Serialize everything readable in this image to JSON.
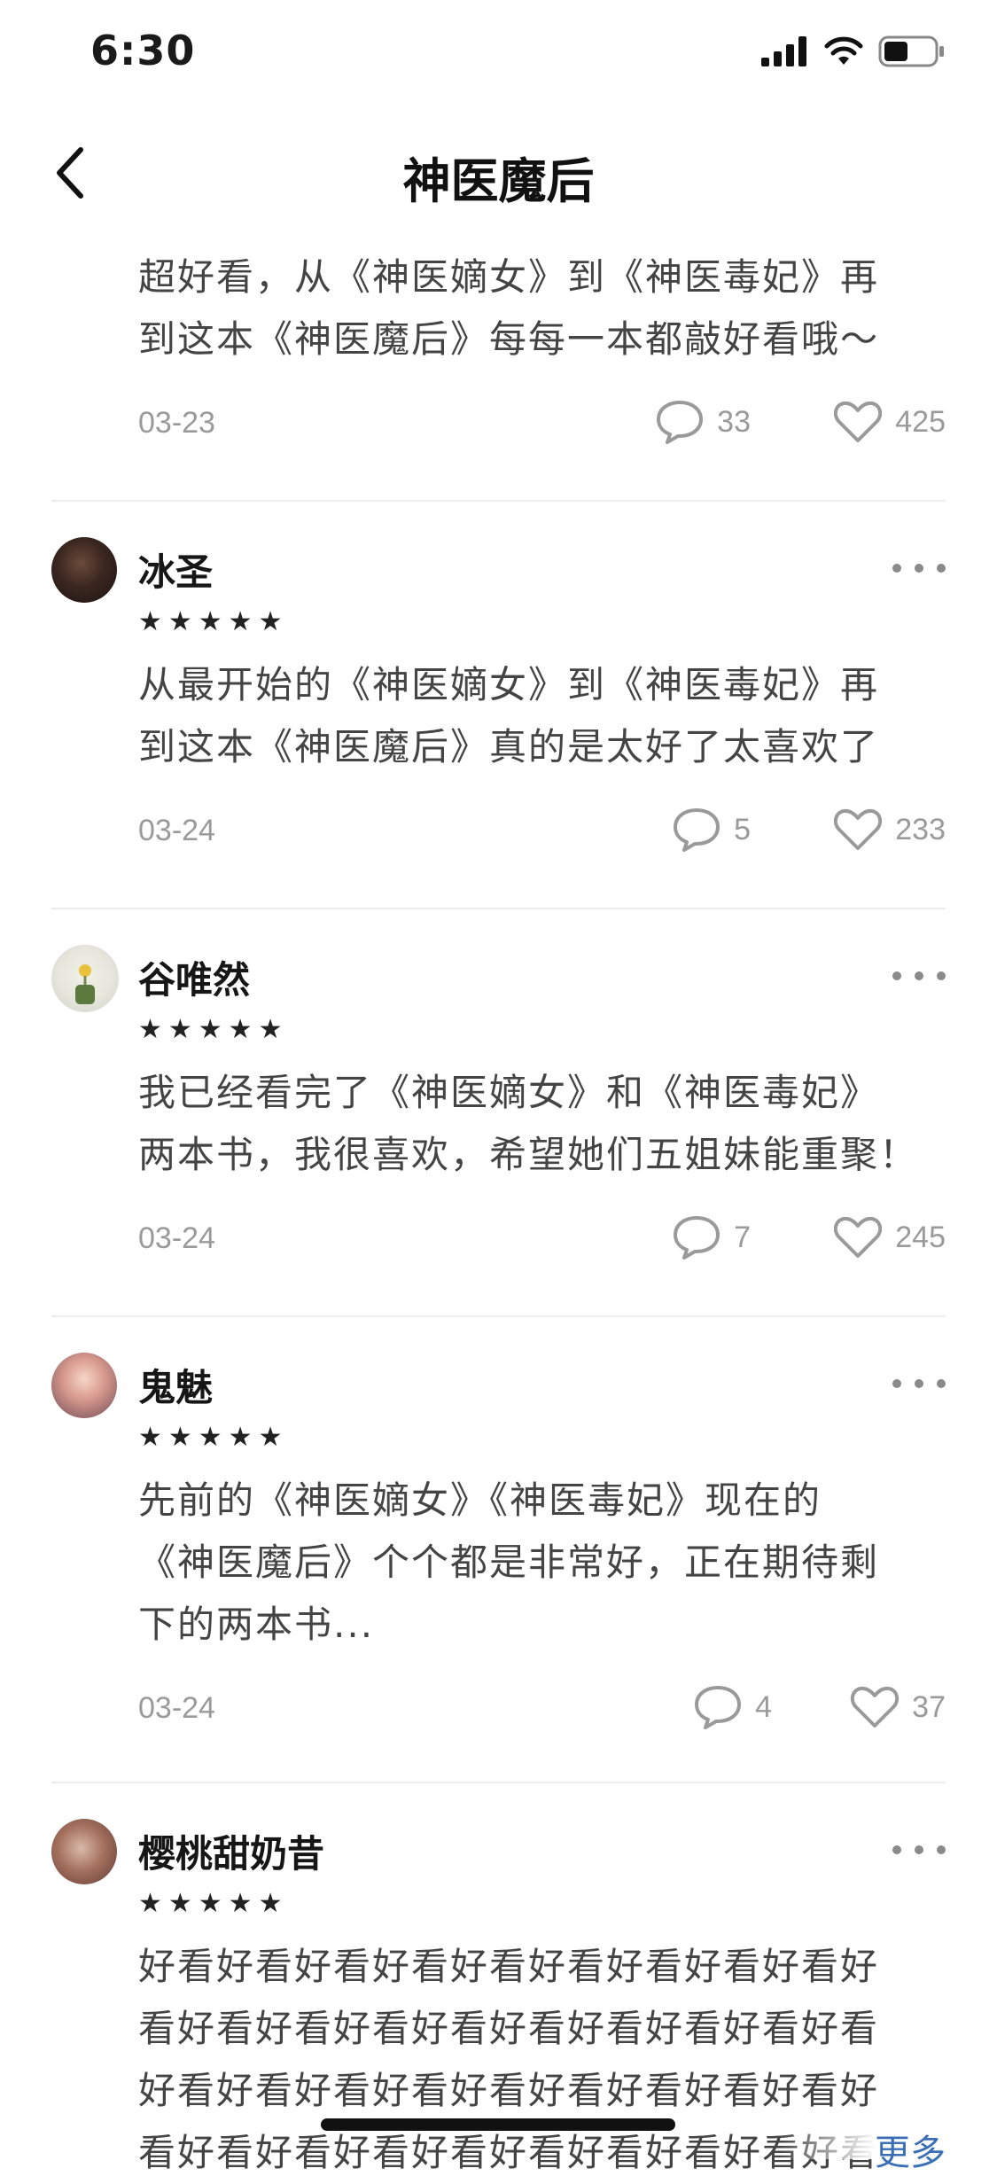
{
  "status_bar": {
    "time": "6:30"
  },
  "nav": {
    "title": "神医魔后"
  },
  "reviews": [
    {
      "content": "超好看，从《神医嫡女》到《神医毒妃》再\n到这本《神医魔后》每每一本都敲好看哦～",
      "date": "03-23",
      "comments": "33",
      "likes": "425"
    },
    {
      "username": "冰圣",
      "stars": "★★★★★",
      "content": "从最开始的《神医嫡女》到《神医毒妃》再\n到这本《神医魔后》真的是太好了太喜欢了",
      "date": "03-24",
      "comments": "5",
      "likes": "233"
    },
    {
      "username": "谷唯然",
      "stars": "★★★★★",
      "content": "我已经看完了《神医嫡女》和《神医毒妃》\n两本书，我很喜欢，希望她们五姐妹能重聚！",
      "date": "03-24",
      "comments": "7",
      "likes": "245"
    },
    {
      "username": "鬼魅",
      "stars": "★★★★★",
      "content": "先前的《神医嫡女》《神医毒妃》现在的\n《神医魔后》个个都是非常好，正在期待剩\n下的两本书...",
      "date": "03-24",
      "comments": "4",
      "likes": "37"
    },
    {
      "username": "樱桃甜奶昔",
      "stars": "★★★★★",
      "content": "好看好看好看好看好看好看好看好看好看好\n看好看好看好看好看好看好看好看好看好看\n好看好看好看好看好看好看好看好看好看好\n看好看好看好看好看好看好看好看好看好看"
    }
  ],
  "more_label": "更多",
  "icons": {
    "back": "chevron-left-icon",
    "comment": "comment-bubble-icon",
    "like": "heart-outline-icon",
    "more": "more-dots-icon"
  },
  "colors": {
    "link": "#3b6fb5",
    "meta": "#9a9a9a",
    "text": "#444444"
  }
}
